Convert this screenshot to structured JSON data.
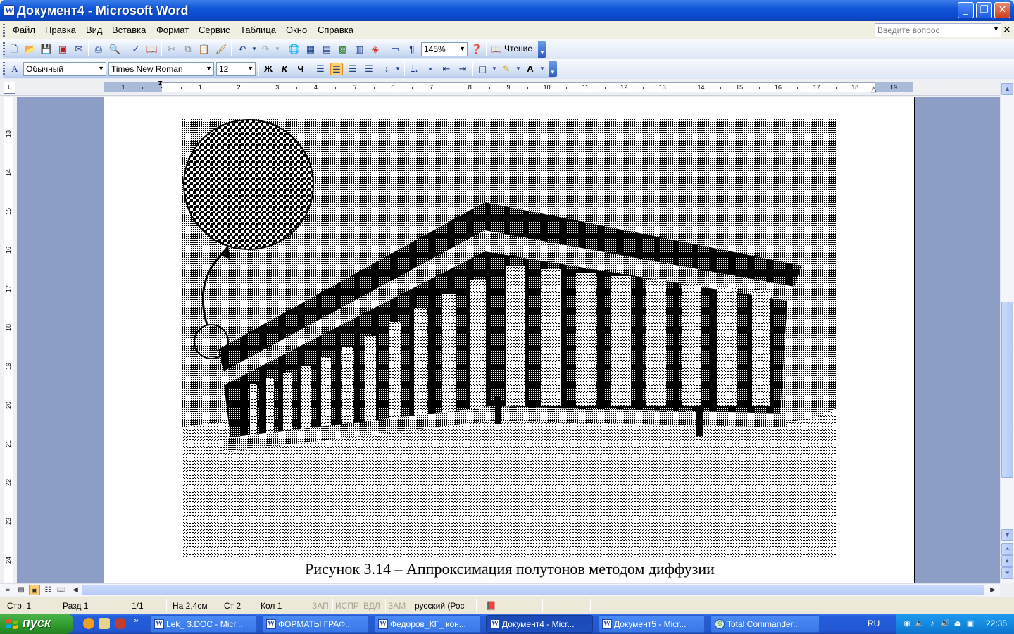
{
  "window": {
    "title": "Документ4 - Microsoft Word",
    "doc_icon_letter": "W",
    "minimize": "_",
    "maximize": "❐",
    "close": "✕"
  },
  "menu": {
    "items": [
      "Файл",
      "Правка",
      "Вид",
      "Вставка",
      "Формат",
      "Сервис",
      "Таблица",
      "Окно",
      "Справка"
    ],
    "help_placeholder": "Введите вопрос",
    "doc_close": "✕"
  },
  "toolbar_standard": {
    "zoom": "145%",
    "reading_label": "Чтение"
  },
  "toolbar_format": {
    "style": "Обычный",
    "font": "Times New Roman",
    "size": "12",
    "bold": "Ж",
    "italic": "К",
    "underline": "Ч"
  },
  "ruler": {
    "tab_selector": "L",
    "labels": [
      "1",
      "·",
      "1",
      "2",
      "3",
      "4",
      "5",
      "6",
      "7",
      "8",
      "9",
      "10",
      "11",
      "12",
      "13",
      "14",
      "15",
      "16",
      "17",
      "18",
      "19"
    ]
  },
  "vruler": {
    "labels": [
      "13",
      "14",
      "15",
      "16",
      "17",
      "18",
      "19",
      "20",
      "21",
      "22",
      "23",
      "24"
    ]
  },
  "document": {
    "caption": "Рисунок 3.14 – Аппроксимация полутонов методом диффузии",
    "figure_alt": "Parthenon"
  },
  "statusbar": {
    "page": "Стр. 1",
    "section": "Разд 1",
    "pages": "1/1",
    "at": "На 2,4см",
    "line": "Ст 2",
    "column": "Кол 1",
    "rec": "ЗАП",
    "trk": "ИСПР",
    "ext": "ВДЛ",
    "ovr": "ЗАМ",
    "language": "русский (Рос"
  },
  "taskbar": {
    "start": "пуск",
    "more": "»",
    "tasks": [
      {
        "label": "Lek_ 3.DOC - Micr...",
        "active": false
      },
      {
        "label": "ФОРМАТЫ ГРАФ...",
        "active": false
      },
      {
        "label": "Федоров_КГ_ кон...",
        "active": false
      },
      {
        "label": "Документ4 - Micr...",
        "active": true
      },
      {
        "label": "Документ5 - Micr...",
        "active": false
      },
      {
        "label": "Total Commander...",
        "active": false
      }
    ],
    "lang": "RU",
    "clock": "22:35"
  },
  "colors": {
    "title_blue": "#0a49c9",
    "taskbar_blue": "#245edb",
    "start_green": "#2e9a2e",
    "workspace": "#8c9ec5"
  }
}
